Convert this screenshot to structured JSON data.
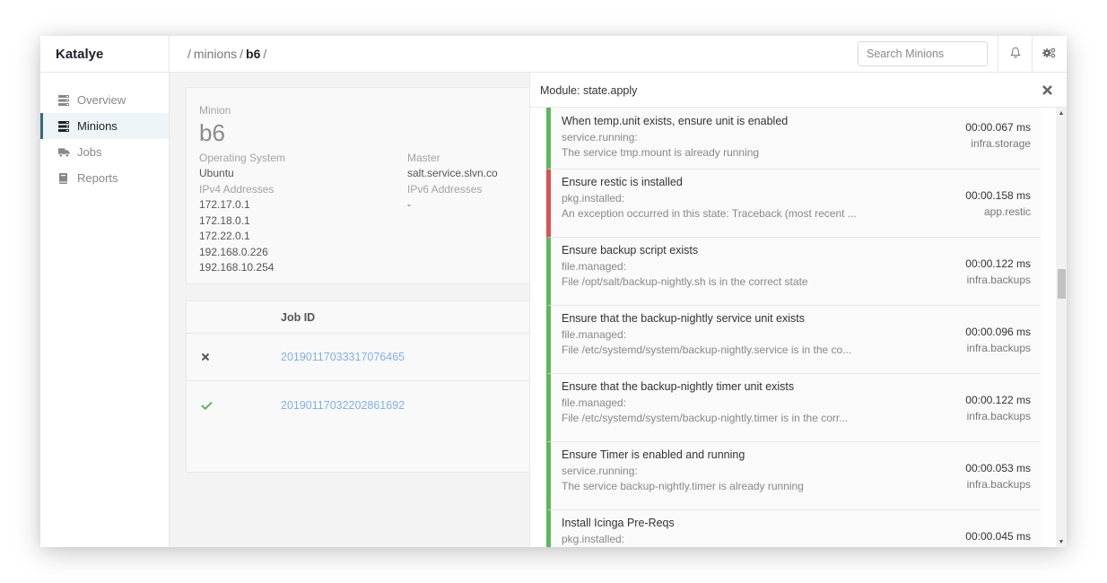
{
  "app": {
    "brand": "Katalye"
  },
  "header": {
    "breadcrumb": [
      {
        "label": "/"
      },
      {
        "label": "minions"
      },
      {
        "label": "/"
      },
      {
        "label": "b6"
      },
      {
        "label": "/"
      }
    ],
    "search_placeholder": "Search Minions",
    "icons": {
      "notifications": "bell-icon",
      "settings": "gears-icon"
    }
  },
  "sidebar": {
    "items": [
      {
        "label": "Overview",
        "icon": "server-icon",
        "active": false
      },
      {
        "label": "Minions",
        "icon": "server-icon",
        "active": true
      },
      {
        "label": "Jobs",
        "icon": "truck-icon",
        "active": false
      },
      {
        "label": "Reports",
        "icon": "book-icon",
        "active": false
      }
    ]
  },
  "minion": {
    "label": "Minion",
    "name": "b6",
    "os_label": "Operating System",
    "os_value": "Ubuntu",
    "master_label": "Master",
    "master_value": "salt.service.slvn.co",
    "ipv4_label": "IPv4 Addresses",
    "ipv4": [
      "172.17.0.1",
      "172.18.0.1",
      "172.22.0.1",
      "192.168.0.226",
      "192.168.10.254"
    ],
    "ipv6_label": "IPv6 Addresses",
    "ipv6_value": "-"
  },
  "jobs": {
    "column_job_id": "Job ID",
    "rows": [
      {
        "status": "failed",
        "job_id": "20190117033317076465"
      },
      {
        "status": "success",
        "job_id": "20190117032202861692"
      }
    ]
  },
  "module_panel": {
    "title": "Module: state.apply",
    "states": [
      {
        "title": "When temp.unit exists, ensure unit is enabled",
        "function": "service.running:",
        "comment": "The service tmp.mount is already running",
        "duration": "00:00.067 ms",
        "sls": "infra.storage",
        "result": "success"
      },
      {
        "title": "Ensure restic is installed",
        "function": "pkg.installed:",
        "comment": "An exception occurred in this state: Traceback (most recent ...",
        "duration": "00:00.158 ms",
        "sls": "app.restic",
        "result": "failed"
      },
      {
        "title": "Ensure backup script exists",
        "function": "file.managed:",
        "comment": "File /opt/salt/backup-nightly.sh is in the correct state",
        "duration": "00:00.122 ms",
        "sls": "infra.backups",
        "result": "success"
      },
      {
        "title": "Ensure that the backup-nightly service unit exists",
        "function": "file.managed:",
        "comment": "File /etc/systemd/system/backup-nightly.service is in the co...",
        "duration": "00:00.096 ms",
        "sls": "infra.backups",
        "result": "success"
      },
      {
        "title": "Ensure that the backup-nightly timer unit exists",
        "function": "file.managed:",
        "comment": "File /etc/systemd/system/backup-nightly.timer is in the corr...",
        "duration": "00:00.122 ms",
        "sls": "infra.backups",
        "result": "success"
      },
      {
        "title": "Ensure Timer is enabled and running",
        "function": "service.running:",
        "comment": "The service backup-nightly.timer is already running",
        "duration": "00:00.053 ms",
        "sls": "infra.backups",
        "result": "success"
      },
      {
        "title": "Install Icinga Pre-Reqs",
        "function": "pkg.installed:",
        "comment": "",
        "duration": "00:00.045 ms",
        "sls": "",
        "result": "success"
      }
    ]
  },
  "colors": {
    "success": "#5cb85c",
    "failed": "#d9534f",
    "link": "#7fb0e8",
    "active_nav_accent": "#2f6f7a"
  }
}
